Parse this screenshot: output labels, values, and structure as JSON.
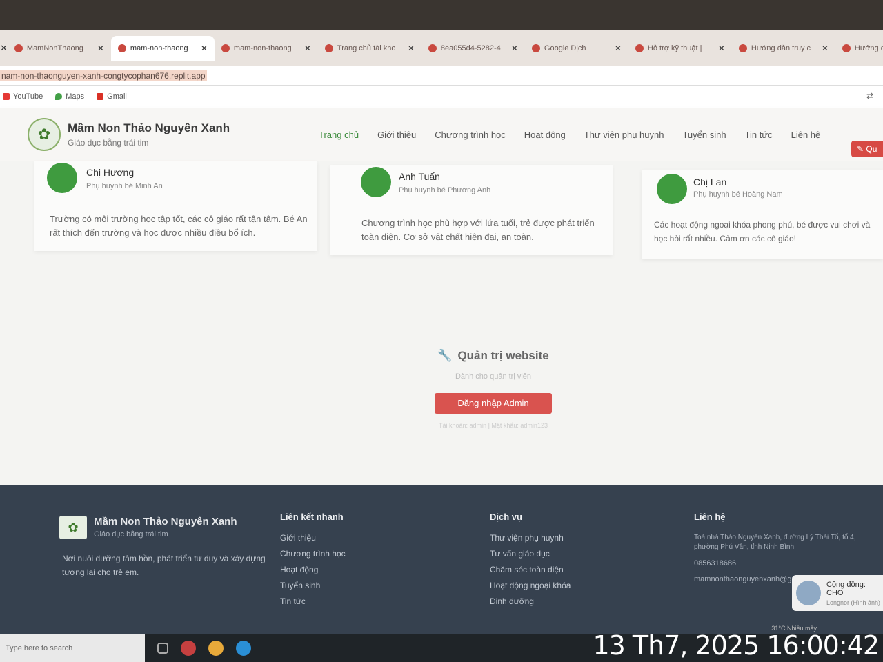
{
  "browser": {
    "tabs": [
      {
        "title": "MamNonThaong",
        "active": false
      },
      {
        "title": "mam-non-thaong",
        "active": true
      },
      {
        "title": "mam-non-thaong",
        "active": false
      },
      {
        "title": "Trang chủ tài kho",
        "active": false
      },
      {
        "title": "8ea055d4-5282-4",
        "active": false
      },
      {
        "title": "Google Dịch",
        "active": false
      },
      {
        "title": "Hỗ trợ kỹ thuật |",
        "active": false
      },
      {
        "title": "Hướng dẫn truy c",
        "active": false
      },
      {
        "title": "Hướng dẫn c",
        "active": false
      }
    ],
    "url": "nam-non-thaonguyen-xanh-congtycophan676.replit.app",
    "bookmarks": [
      {
        "label": "YouTube",
        "color": "#e53935"
      },
      {
        "label": "Maps",
        "color": "#43a047"
      },
      {
        "label": "Gmail",
        "color": "#d93025"
      }
    ]
  },
  "header": {
    "brand_name": "Mầm Non Thảo Nguyên Xanh",
    "tagline": "Giáo dục bằng trái tim",
    "nav": [
      "Trang chủ",
      "Giới thiệu",
      "Chương trình học",
      "Hoạt động",
      "Thư viện phụ huynh",
      "Tuyển sinh",
      "Tin tức",
      "Liên hệ"
    ],
    "cta": "Qu"
  },
  "testimonials": [
    {
      "name": "Chị Hương",
      "role": "Phụ huynh bé Minh An",
      "quote": "Trường có môi trường học tập tốt, các cô giáo rất tận tâm. Bé An rất thích đến trường và học được nhiều điều bổ ích."
    },
    {
      "name": "Anh Tuấn",
      "role": "Phụ huynh bé Phương Anh",
      "quote": "Chương trình học phù hợp với lứa tuổi, trẻ được phát triển toàn diện. Cơ sở vật chất hiện đại, an toàn."
    },
    {
      "name": "Chị Lan",
      "role": "Phụ huynh bé Hoàng Nam",
      "quote": "Các hoạt động ngoại khóa phong phú, bé được vui chơi và học hỏi rất nhiều. Cảm ơn các cô giáo!"
    }
  ],
  "admin": {
    "title": "Quản trị website",
    "subtitle": "Dành cho quản trị viên",
    "button": "Đăng nhập Admin",
    "hint": "Tài khoản: admin | Mật khẩu: admin123"
  },
  "footer": {
    "brand_name": "Mầm Non Thảo Nguyên Xanh",
    "tagline": "Giáo dục bằng trái tim",
    "description": "Nơi nuôi dưỡng tâm hồn, phát triển tư duy và xây dựng tương lai cho trẻ em.",
    "quick_links": {
      "heading": "Liên kết nhanh",
      "items": [
        "Giới thiệu",
        "Chương trình học",
        "Hoạt động",
        "Tuyển sinh",
        "Tin tức"
      ]
    },
    "services": {
      "heading": "Dịch vụ",
      "items": [
        "Thư viện phụ huynh",
        "Tư vấn giáo dục",
        "Chăm sóc toàn diện",
        "Hoạt động ngoại khóa",
        "Dinh dưỡng"
      ]
    },
    "contact": {
      "heading": "Liên hệ",
      "address": "Toà nhà Thảo Nguyên Xanh, đường Lý Thái Tổ, tổ 4, phường Phú Vân, tỉnh Ninh Bình",
      "phone": "0856318686",
      "email": "mamnonthaonguyenxanh@gmail.com"
    }
  },
  "toast": {
    "title": "Cộng đồng: CHO",
    "subtitle": "Longnor (Hình ảnh)"
  },
  "tray": {
    "weather": "31°C  Nhiều mây"
  },
  "taskbar": {
    "search_placeholder": "Type here to search"
  },
  "timestamp": "13 Th7, 2025 16:00:42"
}
